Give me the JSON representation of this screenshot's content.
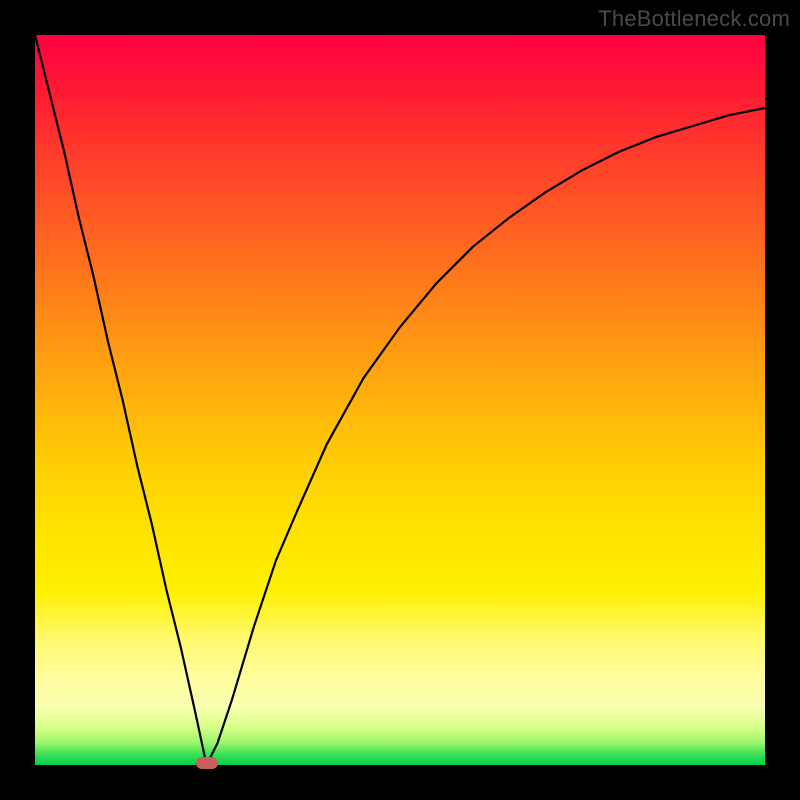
{
  "watermark": "TheBottleneck.com",
  "colors": {
    "frame": "#000000",
    "curve": "#000000",
    "marker": "#c76058"
  },
  "chart_data": {
    "type": "line",
    "title": "",
    "xlabel": "",
    "ylabel": "",
    "xlim": [
      0,
      100
    ],
    "ylim": [
      0,
      100
    ],
    "grid": false,
    "legend": false,
    "series": [
      {
        "name": "bottleneck-curve",
        "x": [
          0,
          2,
          4,
          6,
          8,
          10,
          12,
          14,
          16,
          18,
          20,
          22,
          23.5,
          25,
          27,
          30,
          33,
          36,
          40,
          45,
          50,
          55,
          60,
          65,
          70,
          75,
          80,
          85,
          90,
          95,
          100
        ],
        "y": [
          100,
          92,
          84,
          75,
          67,
          58,
          50,
          41,
          33,
          24,
          16,
          7,
          0,
          3,
          9,
          19,
          28,
          35,
          44,
          53,
          60,
          66,
          71,
          75,
          78.5,
          81.5,
          84,
          86,
          87.5,
          89,
          90
        ]
      }
    ],
    "annotations": [
      {
        "name": "optimal-point",
        "x": 23.5,
        "y": 0,
        "shape": "rounded-rect",
        "color": "#c76058"
      }
    ],
    "background_gradient": {
      "direction": "vertical",
      "stops": [
        {
          "pos": 0.0,
          "color": "#ff0040"
        },
        {
          "pos": 0.25,
          "color": "#ff5a24"
        },
        {
          "pos": 0.52,
          "color": "#ffb80a"
        },
        {
          "pos": 0.76,
          "color": "#fff000"
        },
        {
          "pos": 0.92,
          "color": "#f8ffb0"
        },
        {
          "pos": 1.0,
          "color": "#00d24c"
        }
      ]
    }
  }
}
